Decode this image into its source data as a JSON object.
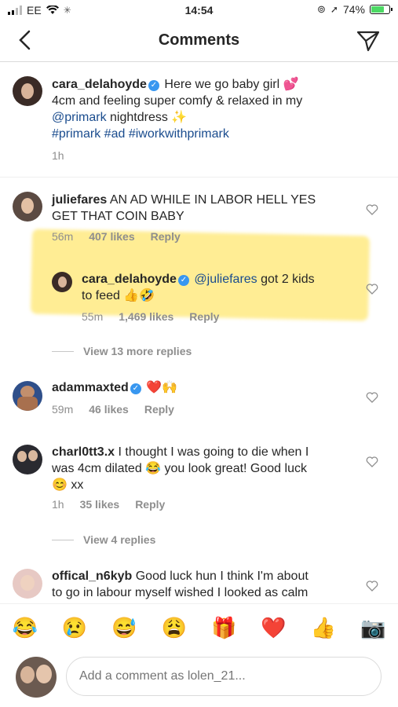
{
  "status": {
    "carrier": "EE",
    "time": "14:54",
    "battery": "74%",
    "battery_level": 0.74
  },
  "header": {
    "title": "Comments"
  },
  "caption": {
    "username": "cara_delahoyde",
    "line1": "Here we go baby girl 💕",
    "line2": "4cm and feeling super comfy & relaxed in my",
    "mention": "@primark",
    "line3_rest": " nightdress ✨",
    "hashtags": "#primark #ad #iworkwithprimark",
    "time": "1h"
  },
  "comments": [
    {
      "username": "juliefares",
      "text1": "AN AD WHILE IN LABOR HELL YES",
      "text2": "GET THAT COIN BABY",
      "time": "56m",
      "likes": "407 likes",
      "reply": "Reply"
    },
    {
      "username": "cara_delahoyde",
      "mention": "@juliefares",
      "text1": " got 2 kids",
      "text2": "to feed 👍🤣",
      "time": "55m",
      "likes": "1,469 likes",
      "reply": "Reply"
    },
    {
      "username": "adammaxted",
      "text1": "❤️🙌",
      "time": "59m",
      "likes": "46 likes",
      "reply": "Reply"
    },
    {
      "username": "charl0tt3.x",
      "text1": "I thought I was going to die when I",
      "text2": "was 4cm dilated 😂 you look great! Good luck",
      "text3": "😊 xx",
      "time": "1h",
      "likes": "35 likes",
      "reply": "Reply"
    },
    {
      "username": "offical_n6kyb",
      "text1": "Good luck hun I think I'm about",
      "text2": "to go in labour myself wished I looked as calm"
    }
  ],
  "view_more": [
    "View 13 more replies",
    "View 4 replies"
  ],
  "emojis": [
    "😂",
    "😢",
    "😅",
    "😩",
    "🎁",
    "❤️",
    "👍",
    "📷"
  ],
  "input": {
    "placeholder": "Add a comment as lolen_21..."
  },
  "colors": {
    "link": "#1a4c8e",
    "verified": "#3897f0",
    "muted": "#8e8e8e",
    "highlight": "#ffde3c"
  }
}
